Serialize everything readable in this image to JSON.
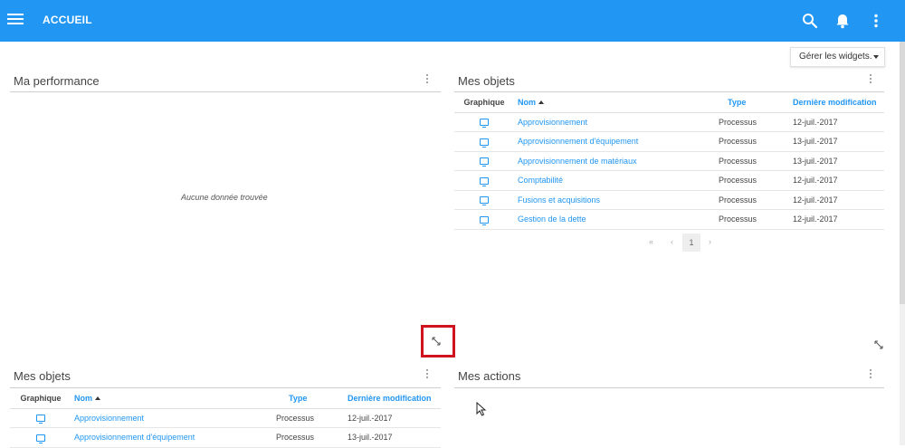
{
  "header": {
    "title": "ACCUEIL",
    "bg_color": "#2196f3",
    "icons": [
      "menu-icon",
      "search-icon",
      "bell-icon",
      "more-vert-icon"
    ]
  },
  "toolbar": {
    "manage_widgets_label": "Gérer les widgets."
  },
  "perf_widget": {
    "title": "Ma performance",
    "empty_message": "Aucune donnée trouvée"
  },
  "objects_widget": {
    "title": "Mes objets",
    "columns": {
      "graph": "Graphique",
      "name": "Nom",
      "type": "Type",
      "modified": "Dernière modification"
    },
    "rows": [
      {
        "name": "Approvisionnement",
        "type": "Processus",
        "modified": "12-juil.-2017"
      },
      {
        "name": "Approvisionnement d'équipement",
        "type": "Processus",
        "modified": "13-juil.-2017"
      },
      {
        "name": "Approvisionnement de matériaux",
        "type": "Processus",
        "modified": "13-juil.-2017"
      },
      {
        "name": "Comptabilité",
        "type": "Processus",
        "modified": "12-juil.-2017"
      },
      {
        "name": "Fusions et acquisitions",
        "type": "Processus",
        "modified": "12-juil.-2017"
      },
      {
        "name": "Gestion de la dette",
        "type": "Processus",
        "modified": "12-juil.-2017"
      }
    ],
    "pagination": {
      "current_page": "1"
    }
  },
  "objects_widget_2": {
    "title": "Mes objets",
    "columns": {
      "graph": "Graphique",
      "name": "Nom",
      "type": "Type",
      "modified": "Dernière modification"
    },
    "rows": [
      {
        "name": "Approvisionnement",
        "type": "Processus",
        "modified": "12-juil.-2017"
      },
      {
        "name": "Approvisionnement d'équipement",
        "type": "Processus",
        "modified": "13-juil.-2017"
      }
    ]
  },
  "actions_widget": {
    "title": "Mes actions"
  },
  "highlight_color": "#d0131f"
}
